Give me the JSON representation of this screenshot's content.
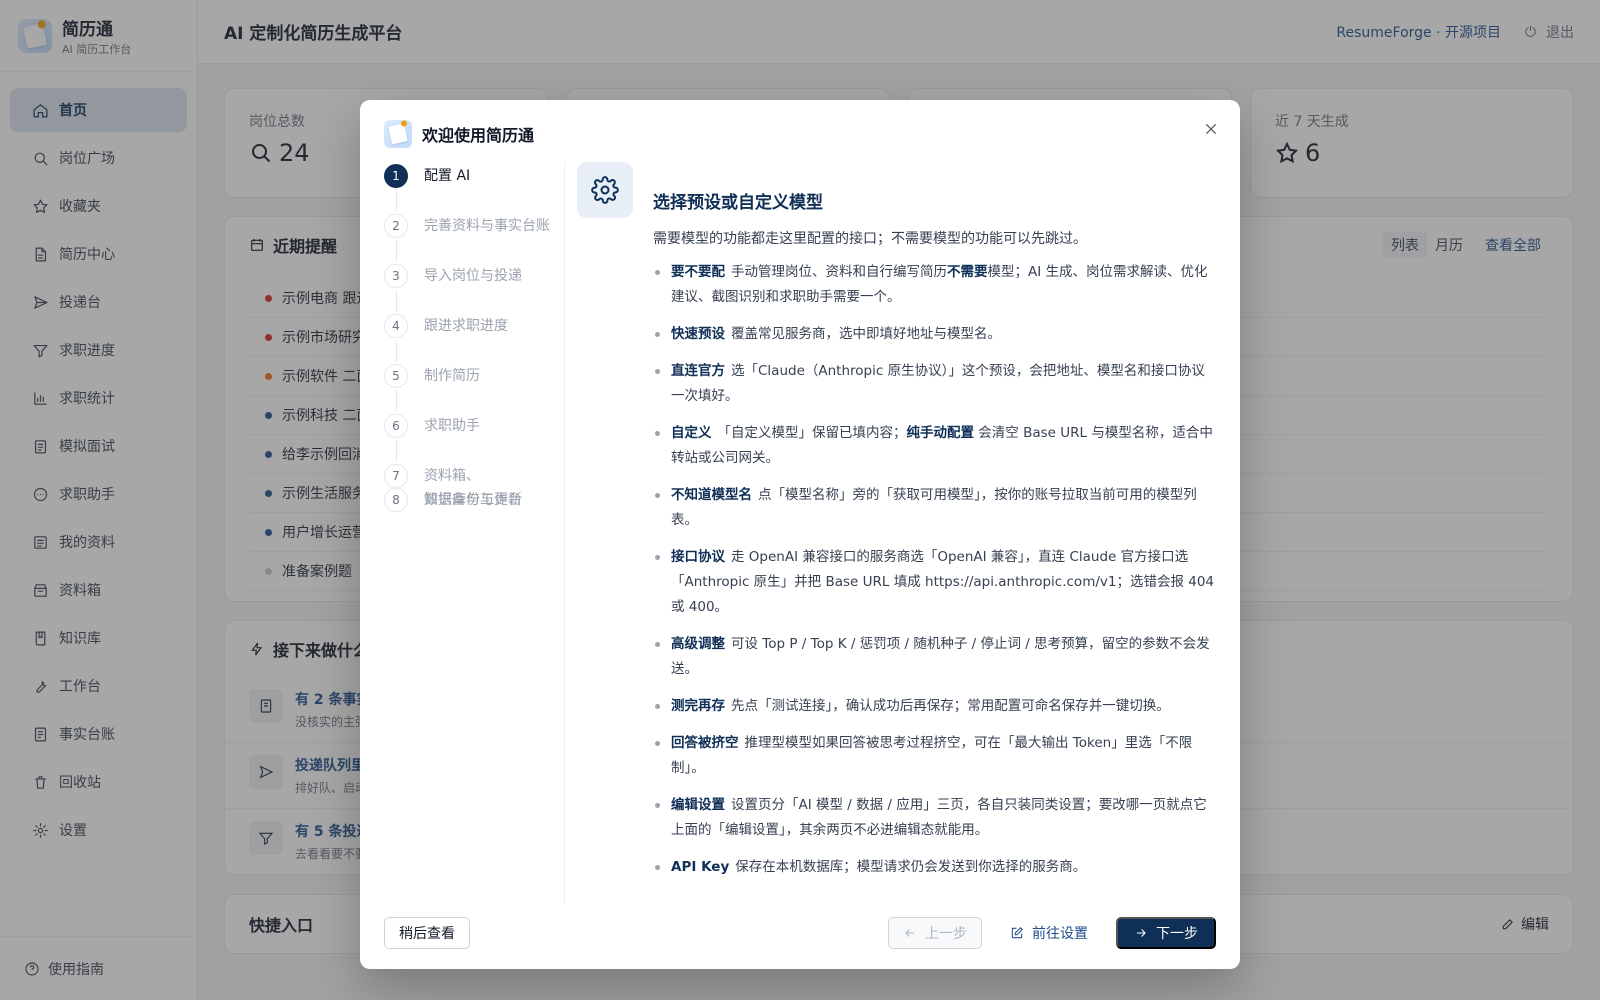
{
  "sidebar": {
    "brand_name": "简历通",
    "brand_sub": "AI 简历工作台",
    "items": [
      {
        "label": "首页"
      },
      {
        "label": "岗位广场"
      },
      {
        "label": "收藏夹"
      },
      {
        "label": "简历中心"
      },
      {
        "label": "投递台"
      },
      {
        "label": "求职进度"
      },
      {
        "label": "求职统计"
      },
      {
        "label": "模拟面试"
      },
      {
        "label": "求职助手"
      },
      {
        "label": "我的资料"
      },
      {
        "label": "资料箱"
      },
      {
        "label": "知识库"
      },
      {
        "label": "工作台"
      },
      {
        "label": "事实台账"
      },
      {
        "label": "回收站"
      },
      {
        "label": "设置"
      }
    ],
    "footer": "使用指南"
  },
  "header": {
    "title": "AI 定制化简历生成平台",
    "link": "ResumeForge · 开源项目",
    "logout": "退出"
  },
  "stats": [
    {
      "label": "岗位总数",
      "value": "24"
    },
    {
      "label": "",
      "value": ""
    },
    {
      "label": "",
      "value": ""
    },
    {
      "label": "近 7 天生成",
      "value": "6"
    }
  ],
  "reminders": {
    "title": "近期提醒",
    "view_list": "列表",
    "view_calendar": "月历",
    "view_all": "查看全部",
    "items": [
      {
        "text": "示例电商 跟进",
        "color": "#dc2626"
      },
      {
        "text": "示例市场研究",
        "color": "#dc2626"
      },
      {
        "text": "示例软件 二面",
        "color": "#ea7317"
      },
      {
        "text": "示例科技 二面",
        "color": "#1e4e8c"
      },
      {
        "text": "给李示例回消息",
        "color": "#1e4e8c"
      },
      {
        "text": "示例生活服务",
        "color": "#1e4e8c"
      },
      {
        "text": "用户增长运营",
        "color": "#1e4e8c"
      },
      {
        "text": "准备案例题",
        "color": "#c4c7cc"
      }
    ]
  },
  "todo": {
    "title": "接下来做什么",
    "items": [
      {
        "title": "有 2 条事实",
        "sub": "没核实的主张"
      },
      {
        "title": "投递队列里",
        "sub": "排好队、启动"
      },
      {
        "title": "有 5 条投递",
        "sub": "去看看要不要"
      }
    ]
  },
  "quick": {
    "title": "快捷入口",
    "edit": "编辑"
  },
  "modal": {
    "title": "欢迎使用简历通",
    "steps": [
      {
        "num": "1",
        "label": "配置 AI"
      },
      {
        "num": "2",
        "label": "完善资料与事实台账"
      },
      {
        "num": "3",
        "label": "导入岗位与投递"
      },
      {
        "num": "4",
        "label": "跟进求职进度"
      },
      {
        "num": "5",
        "label": "制作简历"
      },
      {
        "num": "6",
        "label": "求职助手"
      },
      {
        "num": "7",
        "label_1": "资料箱、",
        "label_2": "知识库与工作台"
      },
      {
        "num": "8",
        "label": "数据备份与更新"
      }
    ],
    "content_title": "选择预设或自定义模型",
    "intro": "需要模型的功能都走这里配置的接口；不需要模型的功能可以先跳过。",
    "tips": [
      {
        "key": "要不要配",
        "text_html": "手动管理岗位、资料和自行编写简历<b>不需要</b>模型；AI 生成、岗位需求解读、优化建议、截图识别和求职助手需要一个。"
      },
      {
        "key": "快速预设",
        "text_html": "覆盖常见服务商，选中即填好地址与模型名。"
      },
      {
        "key": "直连官方",
        "text_html": "选「Claude（Anthropic 原生协议）」这个预设，会把地址、模型名和接口协议一次填好。"
      },
      {
        "key": "自定义",
        "text_html": "「自定义模型」保留已填内容；<b>纯手动配置</b> 会清空 Base URL 与模型名称，适合中转站或公司网关。"
      },
      {
        "key": "不知道模型名",
        "text_html": "点「模型名称」旁的「获取可用模型」，按你的账号拉取当前可用的模型列表。"
      },
      {
        "key": "接口协议",
        "text_html": "走 OpenAI 兼容接口的服务商选「OpenAI 兼容」，直连 Claude 官方接口选「Anthropic 原生」并把 Base URL 填成 https://api.anthropic.com/v1；选错会报 404 或 400。"
      },
      {
        "key": "高级调整",
        "text_html": "可设 Top P / Top K / 惩罚项 / 随机种子 / 停止词 / 思考预算，留空的参数不会发送。"
      },
      {
        "key": "测完再存",
        "text_html": "先点「测试连接」，确认成功后再保存；常用配置可命名保存并一键切换。"
      },
      {
        "key": "回答被挤空",
        "text_html": "推理型模型如果回答被思考过程挤空，可在「最大输出 Token」里选「不限制」。"
      },
      {
        "key": "编辑设置",
        "text_html": "设置页分「AI 模型 / 数据 / 应用」三页，各自只装同类设置；要改哪一页就点它上面的「编辑设置」，其余两页不必进编辑态就能用。"
      },
      {
        "key": "API Key",
        "text_html": "保存在本机数据库；模型请求仍会发送到你选择的服务商。"
      }
    ],
    "later": "稍后查看",
    "prev": "上一步",
    "goto_settings": "前往设置",
    "next": "下一步"
  }
}
